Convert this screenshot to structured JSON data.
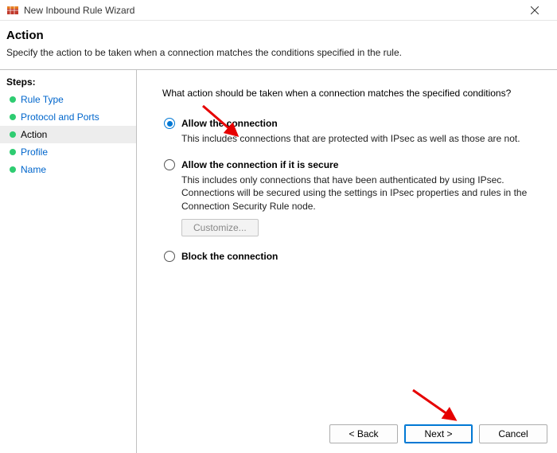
{
  "window": {
    "title": "New Inbound Rule Wizard"
  },
  "header": {
    "title": "Action",
    "subtitle": "Specify the action to be taken when a connection matches the conditions specified in the rule."
  },
  "sidebar": {
    "heading": "Steps:",
    "items": [
      {
        "label": "Rule Type",
        "current": false
      },
      {
        "label": "Protocol and Ports",
        "current": false
      },
      {
        "label": "Action",
        "current": true
      },
      {
        "label": "Profile",
        "current": false
      },
      {
        "label": "Name",
        "current": false
      }
    ]
  },
  "content": {
    "question": "What action should be taken when a connection matches the specified conditions?",
    "options": [
      {
        "id": "allow",
        "label": "Allow the connection",
        "description": "This includes connections that are protected with IPsec as well as those are not.",
        "selected": true
      },
      {
        "id": "allow-secure",
        "label": "Allow the connection if it is secure",
        "description": "This includes only connections that have been authenticated by using IPsec.  Connections will be secured using the settings in IPsec properties and rules in the Connection Security Rule node.",
        "selected": false,
        "customize_label": "Customize..."
      },
      {
        "id": "block",
        "label": "Block the connection",
        "description": "",
        "selected": false
      }
    ]
  },
  "footer": {
    "back": "< Back",
    "next": "Next >",
    "cancel": "Cancel"
  }
}
